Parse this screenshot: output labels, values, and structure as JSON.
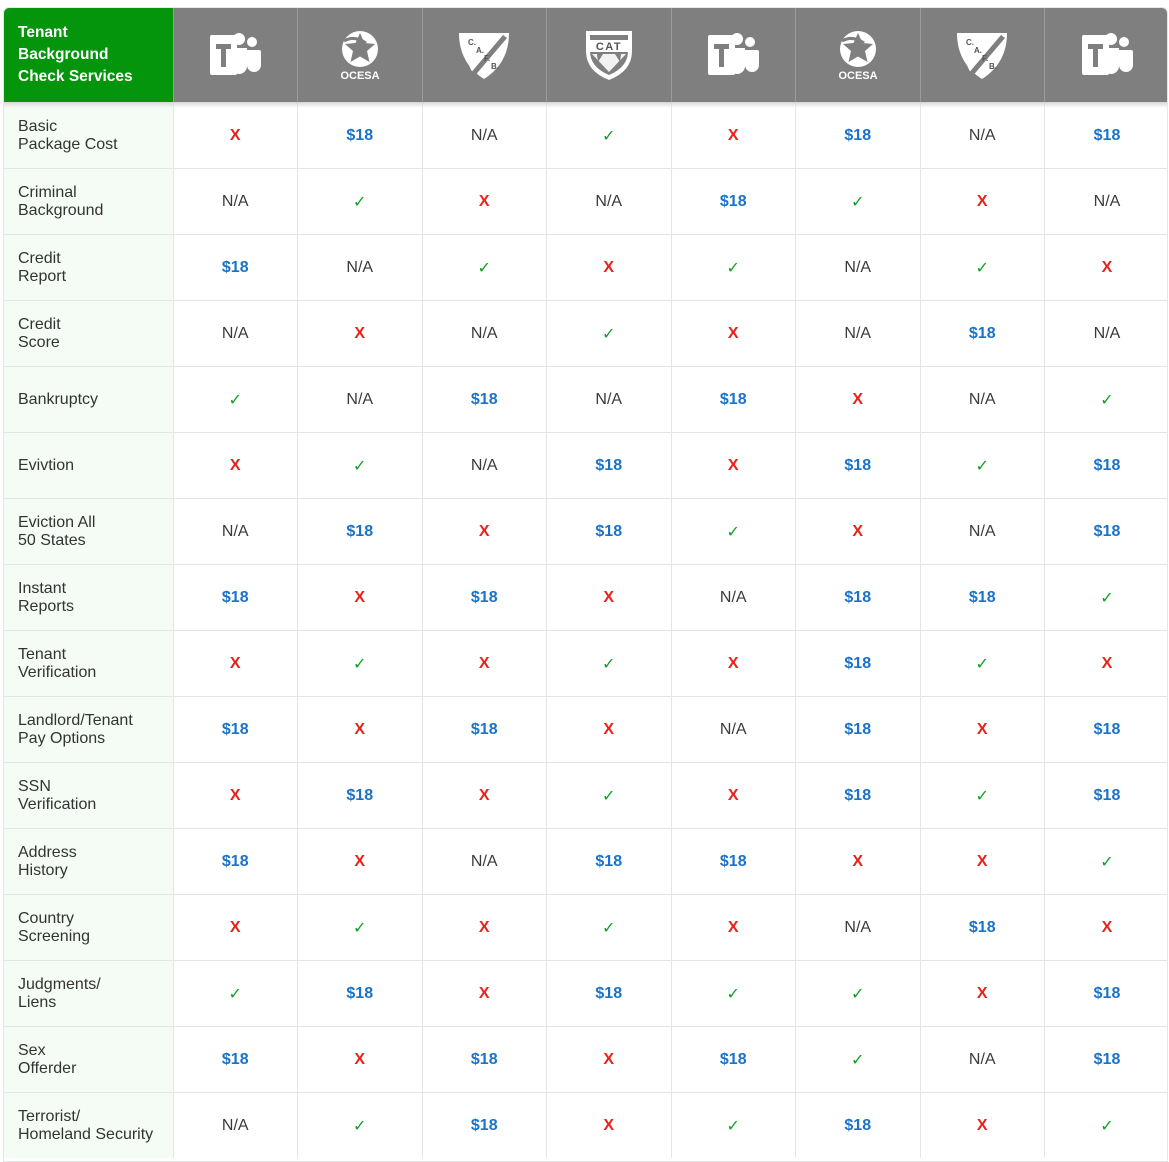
{
  "header": {
    "title_lines": [
      "Tenant",
      "Background",
      "Check Services"
    ],
    "vendors": [
      {
        "name": "teams-logo",
        "icon": "teams-logo-icon",
        "text": "T"
      },
      {
        "name": "ocesa-logo",
        "icon": "ocesa-logo-icon",
        "text": "OCESA"
      },
      {
        "name": "cafb-logo",
        "icon": "cafb-shield-icon",
        "text": "C.A.F.B."
      },
      {
        "name": "cat-logo",
        "icon": "cat-shield-icon",
        "text": "CAT"
      },
      {
        "name": "teams-logo",
        "icon": "teams-logo-icon",
        "text": "T"
      },
      {
        "name": "ocesa-logo",
        "icon": "ocesa-logo-icon",
        "text": "OCESA"
      },
      {
        "name": "cafb-logo",
        "icon": "cafb-shield-icon",
        "text": "C.A.F.B."
      },
      {
        "name": "teams-logo",
        "icon": "teams-logo-icon",
        "text": "T"
      }
    ]
  },
  "colors": {
    "header_green": "#04950d",
    "header_gray": "#7f7f7f",
    "price_blue": "#1a73c8",
    "no_red": "#e8221b",
    "yes_green": "#139e27"
  },
  "rows": [
    {
      "feature": [
        "Basic",
        "Package Cost"
      ],
      "values": [
        "X",
        "$18",
        "N/A",
        "✓",
        "X",
        "$18",
        "N/A",
        "$18"
      ]
    },
    {
      "feature": [
        "Criminal",
        "Background"
      ],
      "values": [
        "N/A",
        "✓",
        "X",
        "N/A",
        "$18",
        "✓",
        "X",
        "N/A"
      ]
    },
    {
      "feature": [
        "Credit",
        "Report"
      ],
      "values": [
        "$18",
        "N/A",
        "✓",
        "X",
        "✓",
        "N/A",
        "✓",
        "X"
      ]
    },
    {
      "feature": [
        "Credit",
        "Score"
      ],
      "values": [
        "N/A",
        "X",
        "N/A",
        "✓",
        "X",
        "N/A",
        "$18",
        "N/A"
      ]
    },
    {
      "feature": [
        "Bankruptcy"
      ],
      "values": [
        "✓",
        "N/A",
        "$18",
        "N/A",
        "$18",
        "X",
        "N/A",
        "✓"
      ]
    },
    {
      "feature": [
        "Evivtion"
      ],
      "values": [
        "X",
        "✓",
        "N/A",
        "$18",
        "X",
        "$18",
        "✓",
        "$18"
      ]
    },
    {
      "feature": [
        "Eviction All",
        "50 States"
      ],
      "values": [
        "N/A",
        "$18",
        "X",
        "$18",
        "✓",
        "X",
        "N/A",
        "$18"
      ]
    },
    {
      "feature": [
        "Instant",
        "Reports"
      ],
      "values": [
        "$18",
        "X",
        "$18",
        "X",
        "N/A",
        "$18",
        "$18",
        "✓"
      ]
    },
    {
      "feature": [
        "Tenant",
        "Verification"
      ],
      "values": [
        "X",
        "✓",
        "X",
        "✓",
        "X",
        "$18",
        "✓",
        "X"
      ]
    },
    {
      "feature": [
        "Landlord/Tenant",
        "Pay Options"
      ],
      "values": [
        "$18",
        "X",
        "$18",
        "X",
        "N/A",
        "$18",
        "X",
        "$18"
      ]
    },
    {
      "feature": [
        "SSN",
        "Verification"
      ],
      "values": [
        "X",
        "$18",
        "X",
        "✓",
        "X",
        "$18",
        "✓",
        "$18"
      ]
    },
    {
      "feature": [
        "Address",
        "History"
      ],
      "values": [
        "$18",
        "X",
        "N/A",
        "$18",
        "$18",
        "X",
        "X",
        "✓"
      ]
    },
    {
      "feature": [
        "Country",
        "Screening"
      ],
      "values": [
        "X",
        "✓",
        "X",
        "✓",
        "X",
        "N/A",
        "$18",
        "X"
      ]
    },
    {
      "feature": [
        "Judgments/",
        "Liens"
      ],
      "values": [
        "✓",
        "$18",
        "X",
        "$18",
        "✓",
        "✓",
        "X",
        "$18"
      ]
    },
    {
      "feature": [
        "Sex",
        "Offerder"
      ],
      "values": [
        "$18",
        "X",
        "$18",
        "X",
        "$18",
        "✓",
        "N/A",
        "$18"
      ]
    },
    {
      "feature": [
        "Terrorist/",
        "Homeland Security"
      ],
      "values": [
        "N/A",
        "✓",
        "$18",
        "X",
        "✓",
        "$18",
        "X",
        "✓"
      ]
    }
  ]
}
